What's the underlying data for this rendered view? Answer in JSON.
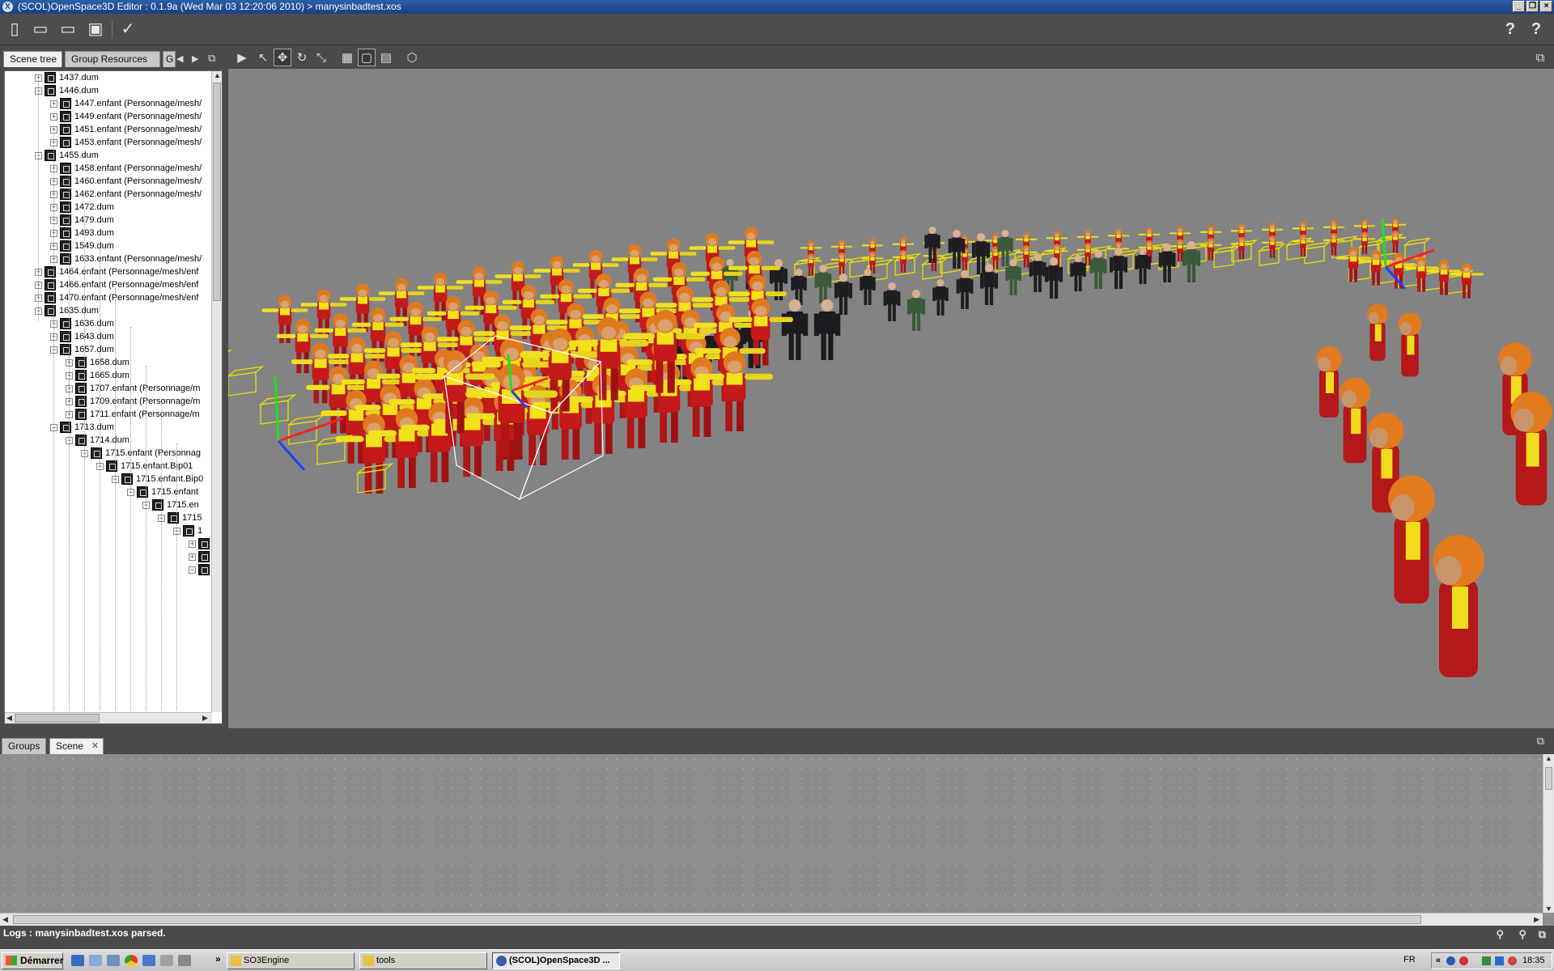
{
  "window": {
    "title": "(SCOL)OpenSpace3D Editor : 0.1.9a (Wed Mar 03 12:20:06 2010) > manysinbadtest.xos",
    "app_icon": "X"
  },
  "left_tabs": [
    "Scene tree",
    "Group Resources",
    "G"
  ],
  "tree": [
    {
      "label": "1437.dum",
      "depth": 0,
      "exp": "+"
    },
    {
      "label": "1446.dum",
      "depth": 0,
      "exp": "-"
    },
    {
      "label": "1447.enfant (Personnage/mesh/",
      "depth": 1,
      "exp": "+"
    },
    {
      "label": "1449.enfant (Personnage/mesh/",
      "depth": 1,
      "exp": "+"
    },
    {
      "label": "1451.enfant (Personnage/mesh/",
      "depth": 1,
      "exp": "+"
    },
    {
      "label": "1453.enfant (Personnage/mesh/",
      "depth": 1,
      "exp": "+"
    },
    {
      "label": "1455.dum",
      "depth": 0,
      "exp": "-"
    },
    {
      "label": "1458.enfant (Personnage/mesh/",
      "depth": 1,
      "exp": "+"
    },
    {
      "label": "1460.enfant (Personnage/mesh/",
      "depth": 1,
      "exp": "+"
    },
    {
      "label": "1462.enfant (Personnage/mesh/",
      "depth": 1,
      "exp": "+"
    },
    {
      "label": "1472.dum",
      "depth": 1,
      "exp": "+"
    },
    {
      "label": "1479.dum",
      "depth": 1,
      "exp": "+"
    },
    {
      "label": "1493.dum",
      "depth": 1,
      "exp": "+"
    },
    {
      "label": "1549.dum",
      "depth": 1,
      "exp": "+"
    },
    {
      "label": "1633.enfant (Personnage/mesh/",
      "depth": 1,
      "exp": "+"
    },
    {
      "label": "1464.enfant (Personnage/mesh/enf",
      "depth": 0,
      "exp": "+"
    },
    {
      "label": "1466.enfant (Personnage/mesh/enf",
      "depth": 0,
      "exp": "+"
    },
    {
      "label": "1470.enfant (Personnage/mesh/enf",
      "depth": 0,
      "exp": "+"
    },
    {
      "label": "1635.dum",
      "depth": 0,
      "exp": "-"
    },
    {
      "label": "1636.dum",
      "depth": 1,
      "exp": "+"
    },
    {
      "label": "1643.dum",
      "depth": 1,
      "exp": "+"
    },
    {
      "label": "1657.dum",
      "depth": 1,
      "exp": "-"
    },
    {
      "label": "1658.dum",
      "depth": 2,
      "exp": "+"
    },
    {
      "label": "1665.dum",
      "depth": 2,
      "exp": "+"
    },
    {
      "label": "1707.enfant (Personnage/m",
      "depth": 2,
      "exp": "+"
    },
    {
      "label": "1709.enfant (Personnage/m",
      "depth": 2,
      "exp": "+"
    },
    {
      "label": "1711.enfant (Personnage/m",
      "depth": 2,
      "exp": "+"
    },
    {
      "label": "1713.dum",
      "depth": 1,
      "exp": "-"
    },
    {
      "label": "1714.dum",
      "depth": 2,
      "exp": "-"
    },
    {
      "label": "1715.enfant (Personnag",
      "depth": 3,
      "exp": "-"
    },
    {
      "label": "1715.enfant.Bip01",
      "depth": 4,
      "exp": "-"
    },
    {
      "label": "1715.enfant.Bip0",
      "depth": 5,
      "exp": "-"
    },
    {
      "label": "1715.enfant",
      "depth": 6,
      "exp": "-"
    },
    {
      "label": "1715.en",
      "depth": 7,
      "exp": "-"
    },
    {
      "label": "1715",
      "depth": 8,
      "exp": "-"
    },
    {
      "label": "1",
      "depth": 9,
      "exp": "-"
    },
    {
      "label": "",
      "depth": 10,
      "exp": "+"
    },
    {
      "label": "",
      "depth": 10,
      "exp": "+"
    },
    {
      "label": "",
      "depth": 10,
      "exp": "-"
    }
  ],
  "bottom_tabs": [
    "Groups",
    "Scene"
  ],
  "logs": "Logs : manysinbadtest.xos parsed.",
  "taskbar": {
    "start": "Démarrer",
    "chevron": "»",
    "tasks": [
      "SO3Engine",
      "tools",
      "(SCOL)OpenSpace3D ..."
    ],
    "lang": "FR",
    "tray_chevron": "«",
    "time": "18:35"
  },
  "icons": {
    "help": "?",
    "user_help": "?"
  },
  "colors": {
    "viewport_bg": "#838383",
    "selection_box": "#ffffff",
    "bbox_yellow": "#e8e000",
    "axis_x": "#ff2020",
    "axis_y": "#20e020",
    "axis_z": "#2040ff"
  }
}
